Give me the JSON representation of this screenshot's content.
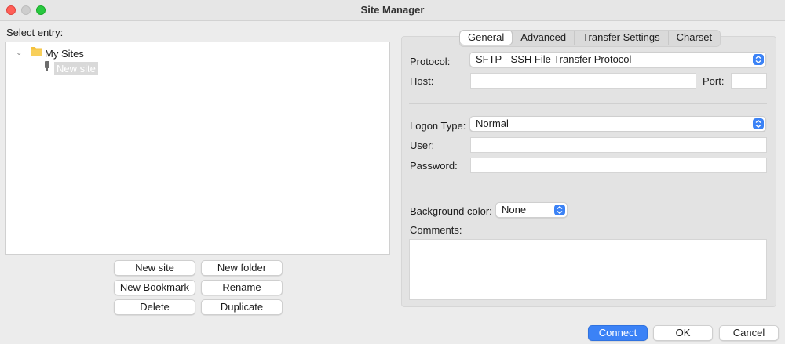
{
  "window": {
    "title": "Site Manager"
  },
  "left": {
    "select_label": "Select entry:",
    "tree": {
      "folder": {
        "label": "My Sites",
        "icon": "folder-icon"
      },
      "site": {
        "label": "New site",
        "icon": "server-icon"
      }
    },
    "buttons": {
      "new_site": "New site",
      "new_folder": "New folder",
      "new_bookmark": "New Bookmark",
      "rename": "Rename",
      "delete": "Delete",
      "duplicate": "Duplicate"
    }
  },
  "tabs": [
    {
      "label": "General",
      "active": true
    },
    {
      "label": "Advanced",
      "active": false
    },
    {
      "label": "Transfer Settings",
      "active": false
    },
    {
      "label": "Charset",
      "active": false
    }
  ],
  "general": {
    "protocol_label": "Protocol:",
    "protocol_value": "SFTP - SSH File Transfer Protocol",
    "host_label": "Host:",
    "host_value": "",
    "port_label": "Port:",
    "port_value": "",
    "logon_type_label": "Logon Type:",
    "logon_type_value": "Normal",
    "user_label": "User:",
    "user_value": "",
    "password_label": "Password:",
    "password_value": "",
    "bg_color_label": "Background color:",
    "bg_color_value": "None",
    "comments_label": "Comments:",
    "comments_value": ""
  },
  "footer": {
    "connect": "Connect",
    "ok": "OK",
    "cancel": "Cancel"
  },
  "colors": {
    "accent": "#3b82f6",
    "close": "#ff5f57",
    "maximize": "#28c840",
    "folder": "#f5c13c"
  }
}
